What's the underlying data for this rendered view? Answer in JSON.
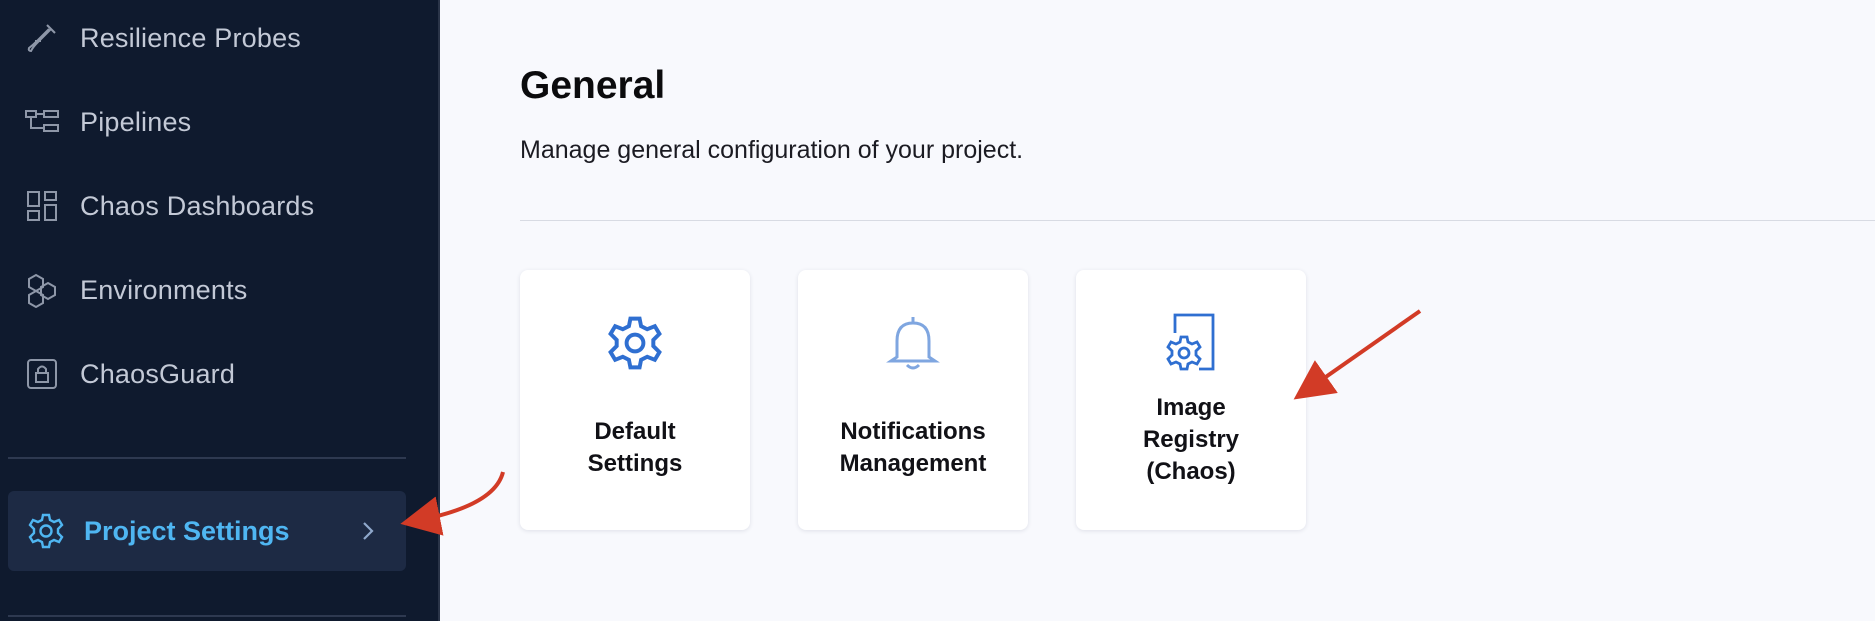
{
  "sidebar": {
    "items": [
      {
        "label": "Resilience Probes",
        "icon": "flask-icon"
      },
      {
        "label": "Pipelines",
        "icon": "pipeline-icon"
      },
      {
        "label": "Chaos Dashboards",
        "icon": "dashboard-icon"
      },
      {
        "label": "Environments",
        "icon": "hexagons-icon"
      },
      {
        "label": "ChaosGuard",
        "icon": "lock-icon"
      }
    ],
    "project_settings": {
      "label": "Project Settings",
      "icon": "gear-icon",
      "active": true
    }
  },
  "main": {
    "title": "General",
    "description": "Manage general configuration of your project.",
    "cards": [
      {
        "label": "Default\nSettings",
        "icon": "gear-icon"
      },
      {
        "label": "Notifications\nManagement",
        "icon": "bell-icon"
      },
      {
        "label": "Image\nRegistry\n(Chaos)",
        "icon": "registry-gear-icon"
      }
    ]
  },
  "colors": {
    "sidebar_bg": "#0f1a2e",
    "active_text": "#4fb6f2",
    "icon_blue": "#2f6fd1",
    "arrow_red": "#d23b26"
  }
}
